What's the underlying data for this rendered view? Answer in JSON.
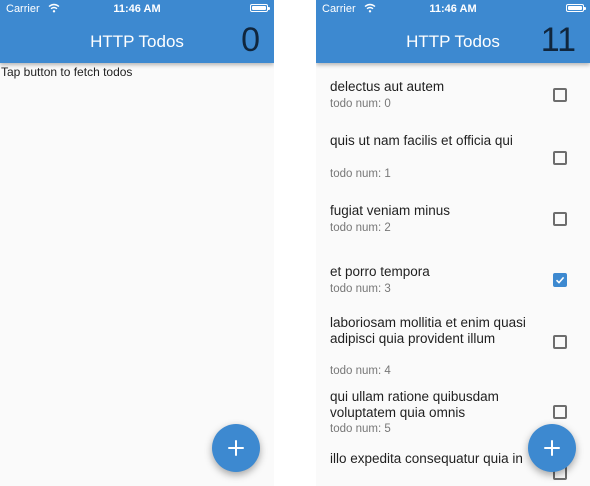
{
  "left_screen": {
    "status": {
      "carrier": "Carrier",
      "time": "11:46 AM"
    },
    "title": "HTTP Todos",
    "count": "0",
    "empty_message": "Tap button to fetch todos",
    "fab_icon": "plus-icon"
  },
  "right_screen": {
    "status": {
      "carrier": "Carrier",
      "time": "11:46 AM"
    },
    "title": "HTTP Todos",
    "count": "11",
    "fab_icon": "plus-icon",
    "todos": [
      {
        "title": "delectus aut autem",
        "subtitle": "todo num: 0",
        "checked": false
      },
      {
        "title": "quis ut nam facilis et officia qui",
        "subtitle": "todo num: 1",
        "checked": false
      },
      {
        "title": "fugiat veniam minus",
        "subtitle": "todo num: 2",
        "checked": false
      },
      {
        "title": "et porro tempora",
        "subtitle": "todo num: 3",
        "checked": true
      },
      {
        "title": "laboriosam mollitia et enim quasi adipisci quia provident illum",
        "subtitle": "todo num: 4",
        "checked": false
      },
      {
        "title": "qui ullam ratione quibusdam voluptatem quia omnis",
        "subtitle": "todo num: 5",
        "checked": false
      },
      {
        "title": "illo expedita consequatur quia in",
        "subtitle": "",
        "checked": false
      }
    ]
  },
  "colors": {
    "primary": "#3d89d0",
    "count_text": "#10263d",
    "background": "#fafafa"
  }
}
